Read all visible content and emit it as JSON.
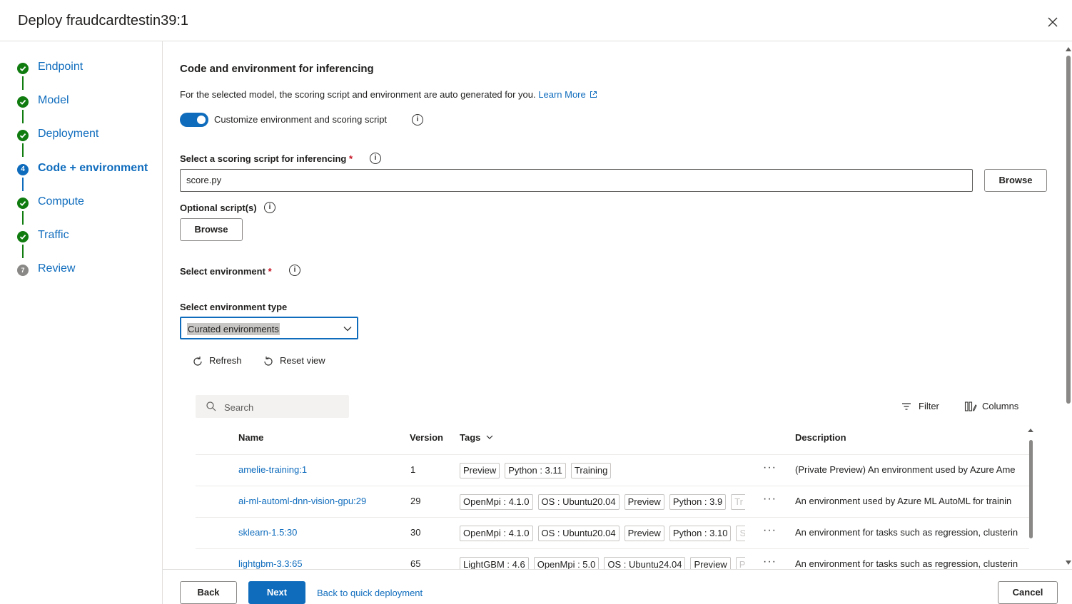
{
  "header": {
    "title": "Deploy fraudcardtestin39:1",
    "close_icon": "close-icon"
  },
  "steps": [
    {
      "label": "Endpoint",
      "status": "done"
    },
    {
      "label": "Model",
      "status": "done"
    },
    {
      "label": "Deployment",
      "status": "done"
    },
    {
      "label": "Code + environment",
      "status": "current",
      "number": "4"
    },
    {
      "label": "Compute",
      "status": "done"
    },
    {
      "label": "Traffic",
      "status": "done"
    },
    {
      "label": "Review",
      "status": "pending",
      "number": "7"
    }
  ],
  "main": {
    "heading": "Code and environment for inferencing",
    "description": "For the selected model, the scoring script and environment are auto generated for you.",
    "learn_more": "Learn More",
    "toggle_label": "Customize environment and scoring script",
    "toggle_on": true,
    "scoring_label": "Select a scoring script for inferencing",
    "scoring_value": "score.py",
    "browse": "Browse",
    "optional_label": "Optional script(s)",
    "env_label": "Select environment",
    "env_type_label": "Select environment type",
    "env_type_value": "Curated environments",
    "refresh": "Refresh",
    "reset_view": "Reset view",
    "search_placeholder": "Search",
    "filter": "Filter",
    "columns": "Columns"
  },
  "table": {
    "headers": {
      "name": "Name",
      "version": "Version",
      "tags": "Tags",
      "description": "Description"
    },
    "rows": [
      {
        "name": "amelie-training:1",
        "version": "1",
        "tags": [
          "Preview",
          "Python : 3.11",
          "Training"
        ],
        "description": "(Private Preview) An environment used by Azure Ame"
      },
      {
        "name": "ai-ml-automl-dnn-vision-gpu:29",
        "version": "29",
        "tags": [
          "OpenMpi : 4.1.0",
          "OS : Ubuntu20.04",
          "Preview",
          "Python : 3.9",
          "Tr"
        ],
        "description": "An environment used by Azure ML AutoML for trainin"
      },
      {
        "name": "sklearn-1.5:30",
        "version": "30",
        "tags": [
          "OpenMpi : 4.1.0",
          "OS : Ubuntu20.04",
          "Preview",
          "Python : 3.10",
          "S"
        ],
        "description": "An environment for tasks such as regression, clusterin"
      },
      {
        "name": "lightgbm-3.3:65",
        "version": "65",
        "tags": [
          "LightGBM : 4.6",
          "OpenMpi : 5.0",
          "OS : Ubuntu24.04",
          "Preview",
          "P"
        ],
        "description": "An environment for tasks such as regression, clusterin"
      }
    ]
  },
  "footer": {
    "back": "Back",
    "next": "Next",
    "quick": "Back to quick deployment",
    "cancel": "Cancel"
  },
  "colors": {
    "accent": "#0f6cbd",
    "success": "#107c10",
    "required": "#c50f1f"
  }
}
